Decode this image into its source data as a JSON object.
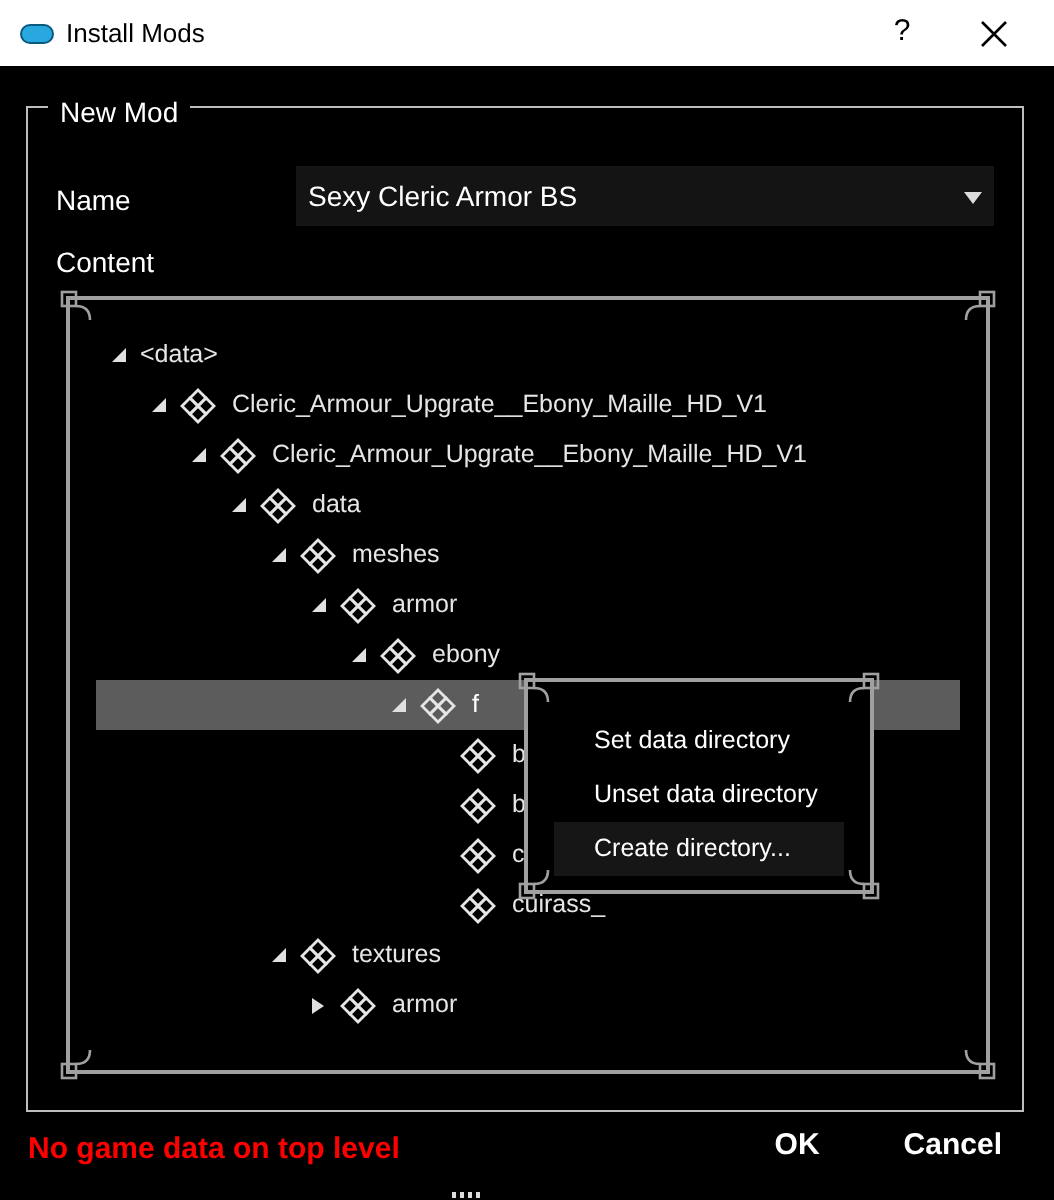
{
  "window": {
    "title": "Install Mods",
    "help": "?"
  },
  "group": {
    "title": "New Mod"
  },
  "name_field": {
    "label": "Name",
    "value": "Sexy Cleric Armor BS"
  },
  "content_label": "Content",
  "tree": [
    {
      "label": "<data>",
      "kind": "root",
      "expanded": true,
      "selected": false,
      "children": [
        {
          "label": "Cleric_Armour_Upgrate__Ebony_Maille_HD_V1",
          "kind": "folder",
          "expanded": true,
          "selected": false,
          "children": [
            {
              "label": "Cleric_Armour_Upgrate__Ebony_Maille_HD_V1",
              "kind": "folder",
              "expanded": true,
              "selected": false,
              "children": [
                {
                  "label": "data",
                  "kind": "folder",
                  "expanded": true,
                  "selected": false,
                  "children": [
                    {
                      "label": "meshes",
                      "kind": "folder",
                      "expanded": true,
                      "selected": false,
                      "children": [
                        {
                          "label": "armor",
                          "kind": "folder",
                          "expanded": true,
                          "selected": false,
                          "children": [
                            {
                              "label": "ebony",
                              "kind": "folder",
                              "expanded": true,
                              "selected": false,
                              "children": [
                                {
                                  "label": "f",
                                  "kind": "folder",
                                  "expanded": true,
                                  "selected": true,
                                  "children": [
                                    {
                                      "label": "b",
                                      "kind": "file",
                                      "selected": false
                                    },
                                    {
                                      "label": "b",
                                      "kind": "file",
                                      "selected": false
                                    },
                                    {
                                      "label": "c",
                                      "kind": "file",
                                      "selected": false
                                    },
                                    {
                                      "label": "cuirass_",
                                      "kind": "file",
                                      "selected": false
                                    }
                                  ]
                                }
                              ]
                            }
                          ]
                        }
                      ]
                    },
                    {
                      "label": "textures",
                      "kind": "folder",
                      "expanded": true,
                      "selected": false,
                      "children": [
                        {
                          "label": "armor",
                          "kind": "folder",
                          "expanded": false,
                          "selected": false
                        }
                      ]
                    }
                  ]
                }
              ]
            }
          ]
        }
      ]
    }
  ],
  "context_menu": [
    {
      "label": "Set data directory",
      "selected": false
    },
    {
      "label": "Unset data directory",
      "selected": false
    },
    {
      "label": "Create directory...",
      "selected": true
    }
  ],
  "error": "No game data on top level",
  "buttons": [
    "OK",
    "Cancel"
  ]
}
